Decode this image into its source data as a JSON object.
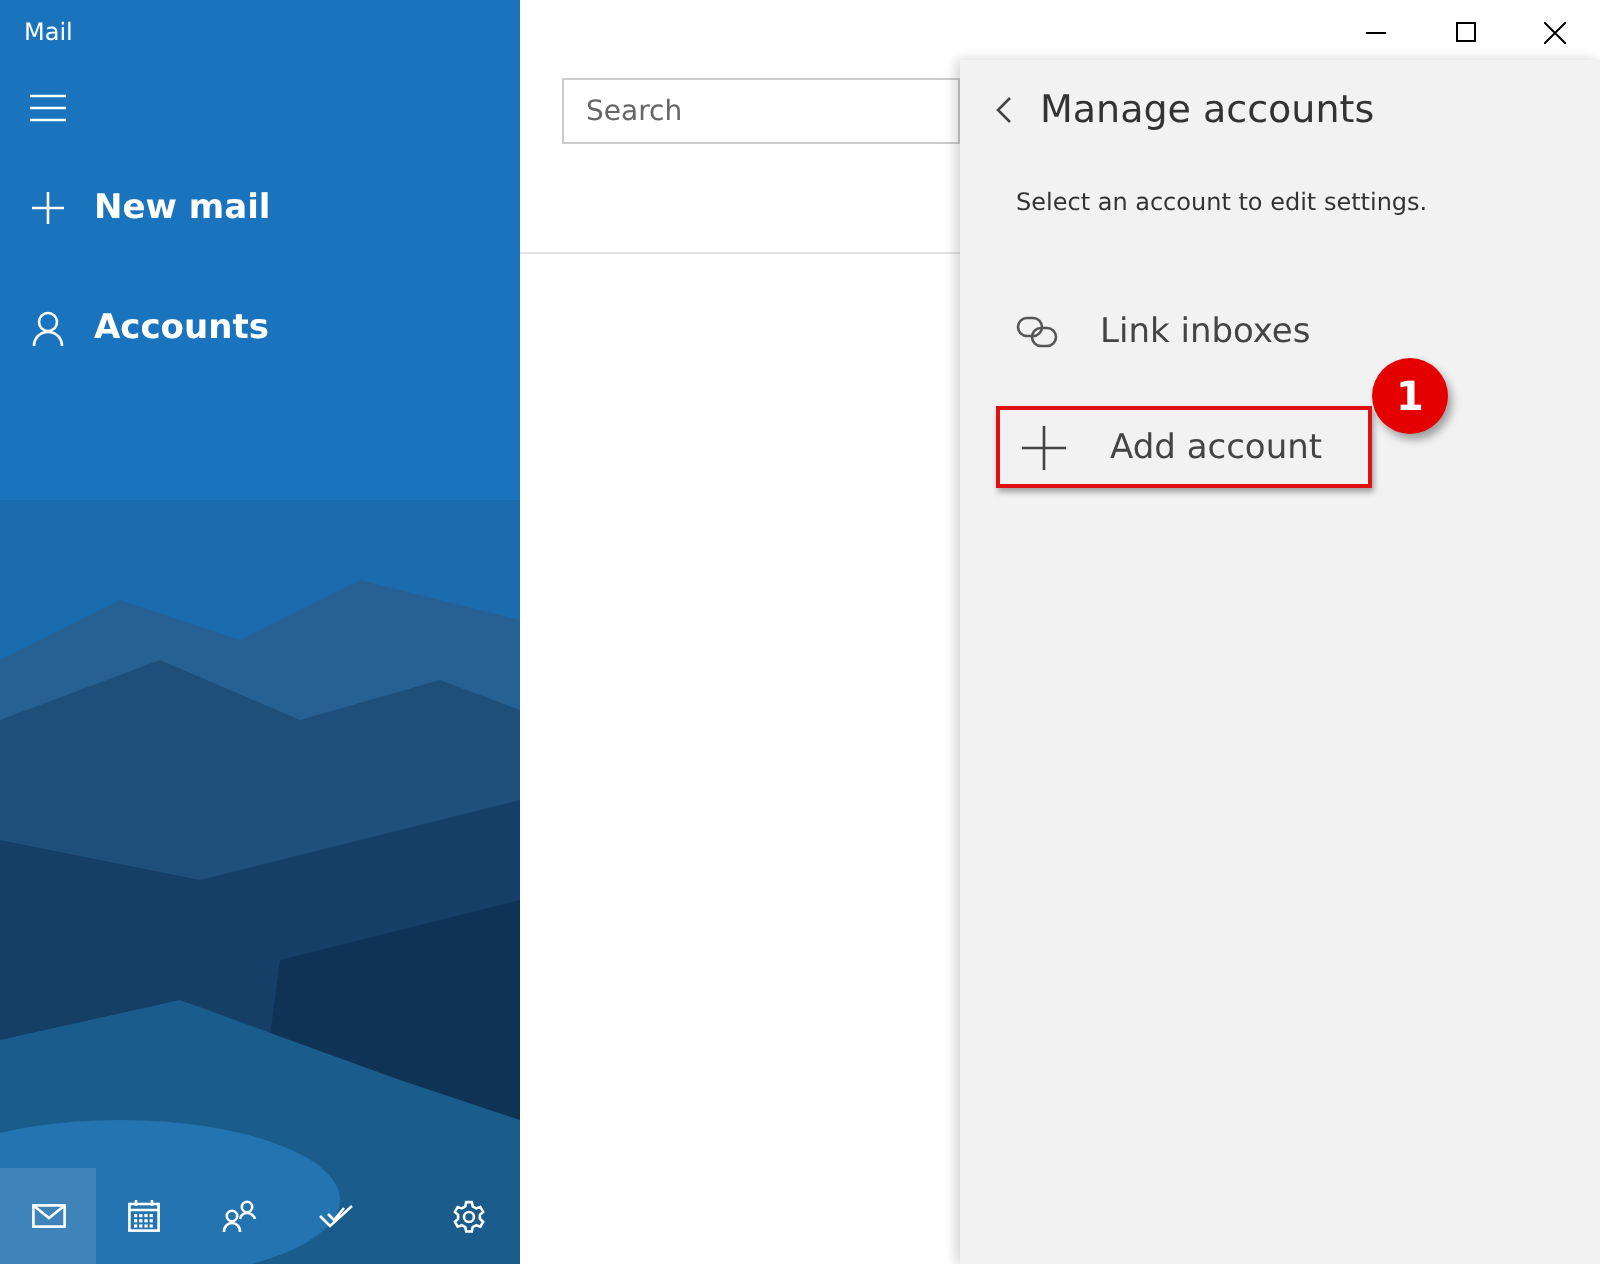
{
  "window": {
    "title": "Mail"
  },
  "sidebar": {
    "items": [
      {
        "kind": "new",
        "label": "New mail"
      },
      {
        "kind": "person",
        "label": "Accounts"
      }
    ]
  },
  "bottom_nav": [
    {
      "kind": "mail",
      "selected": true
    },
    {
      "kind": "calendar",
      "selected": false
    },
    {
      "kind": "people",
      "selected": false
    },
    {
      "kind": "todo",
      "selected": false
    },
    {
      "kind": "settings",
      "selected": false
    }
  ],
  "search": {
    "placeholder": "Search"
  },
  "panel": {
    "title": "Manage accounts",
    "hint": "Select an account to edit settings.",
    "actions": [
      {
        "kind": "link",
        "label": "Link inboxes",
        "highlighted": false
      },
      {
        "kind": "add",
        "label": "Add account",
        "highlighted": true
      }
    ],
    "callout": "1"
  }
}
